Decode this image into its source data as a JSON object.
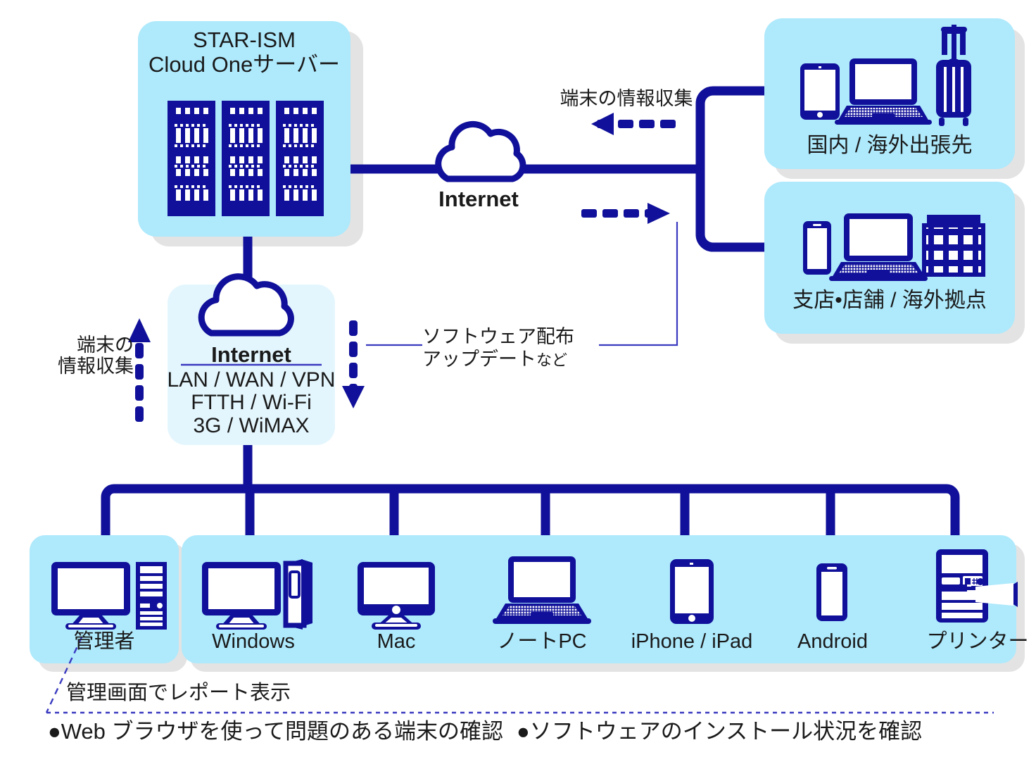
{
  "colors": {
    "navy": "#10109a",
    "navy_dark": "#151585",
    "box_blue": "#aee9fc",
    "box_blue_light": "#e4f6fd",
    "shadow": "#e3e3e3",
    "text": "#1a1a1a",
    "thin_line": "#3a3ac0"
  },
  "server_box": {
    "title_line1": "STAR-ISM",
    "title_line2": "Cloud Oneサーバー",
    "icon": "server-rack-icon"
  },
  "internet_cloud_top": {
    "label": "Internet",
    "icon": "cloud-icon"
  },
  "internet_box": {
    "label": "Internet",
    "sub_lines": [
      "LAN / WAN / VPN",
      "FTTH / Wi-Fi",
      "3G / WiMAX"
    ],
    "icon": "cloud-icon"
  },
  "flows": {
    "collect_top": "端末の情報収集",
    "collect_left_line1": "端末の",
    "collect_left_line2": "情報収集",
    "distribute_line1": "ソフトウェア配布",
    "distribute_line2_main": "アップデート",
    "distribute_line2_suffix": "など"
  },
  "remote_sites": [
    {
      "caption": "国内 / 海外出張先",
      "icons": [
        "tablet-icon",
        "laptop-icon",
        "suitcase-icon"
      ]
    },
    {
      "caption": "支店•店舗 / 海外拠点",
      "icons": [
        "smartphone-icon",
        "laptop-icon",
        "office-building-icon"
      ]
    }
  ],
  "admin": {
    "caption": "管理者",
    "icon": "desktop-pc-icon"
  },
  "devices": [
    {
      "caption": "Windows",
      "icon": "desktop-tower-icon"
    },
    {
      "caption": "Mac",
      "icon": "imac-icon"
    },
    {
      "caption": "ノートPC",
      "icon": "notebook-icon"
    },
    {
      "caption": "iPhone / iPad",
      "icon": "tablet-icon"
    },
    {
      "caption": "Android",
      "icon": "smartphone-icon"
    },
    {
      "caption": "プリンター",
      "icon": "printer-icon"
    }
  ],
  "footer": {
    "note": "管理画面でレポート表示",
    "bullets": [
      "●Web ブラウザを使って問題のある端末の確認",
      "●ソフトウェアのインストール状況を確認"
    ]
  }
}
